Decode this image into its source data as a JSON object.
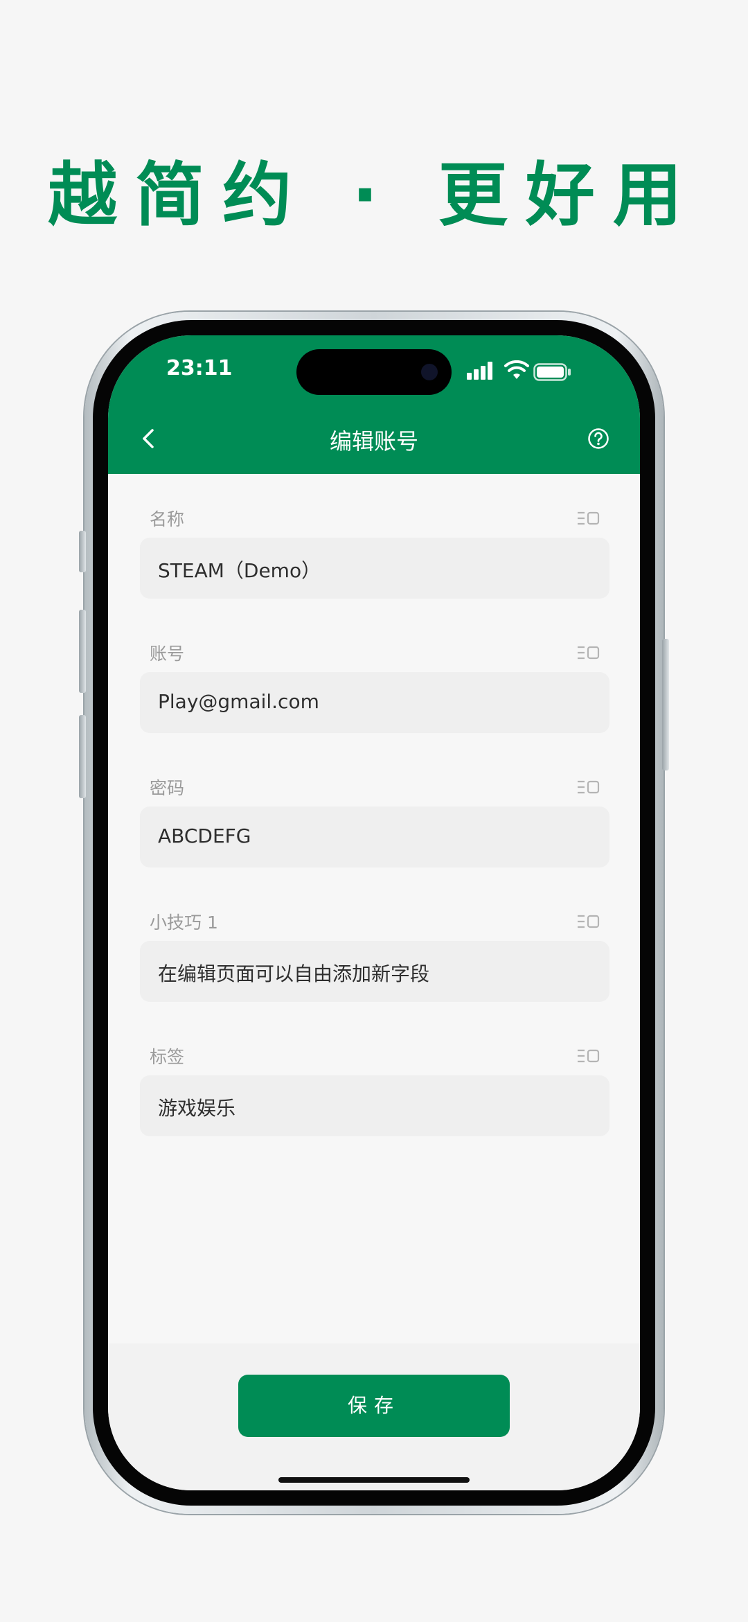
{
  "headline": "越简约 · 更好用",
  "status_bar": {
    "time": "23:11"
  },
  "nav": {
    "title": "编辑账号"
  },
  "fields": [
    {
      "label": "名称",
      "value": "STEAM（Demo）"
    },
    {
      "label": "账号",
      "value": "Play@gmail.com"
    },
    {
      "label": "密码",
      "value": "ABCDEFG"
    },
    {
      "label": "小技巧 1",
      "value": "在编辑页面可以自由添加新字段"
    },
    {
      "label": "标签",
      "value": "游戏娱乐"
    }
  ],
  "save_label": "保存",
  "icons": {
    "back": "chevron-left-icon",
    "help": "help-circle-icon",
    "field_menu": "field-options-icon",
    "signal": "cellular-signal-icon",
    "wifi": "wifi-icon",
    "battery": "battery-icon"
  },
  "colors": {
    "brand": "#008c55",
    "page_bg": "#f6f6f6",
    "field_bg": "#efefef"
  }
}
